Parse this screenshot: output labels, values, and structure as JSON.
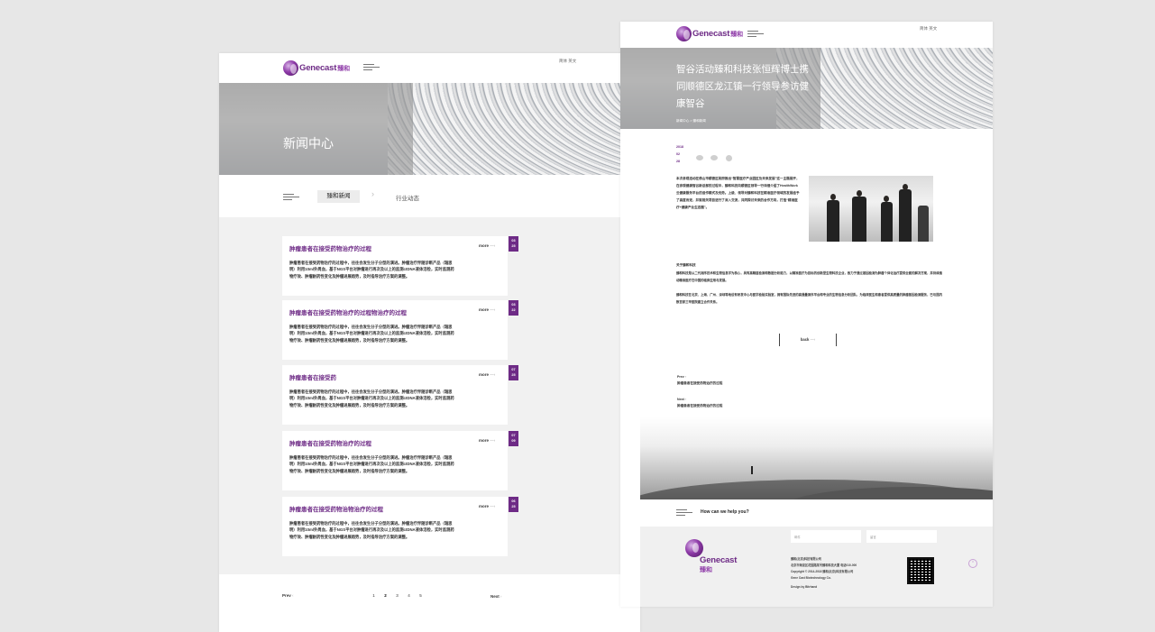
{
  "brand": {
    "logo_text": "Genecast",
    "logo_cn": "臻和",
    "accent": "#6e2b86"
  },
  "news_page": {
    "lang": "简体 英文",
    "hero_title": "新闻中心",
    "tabs": {
      "active": "臻和新闻",
      "other": "行业动态"
    },
    "more_label": "more",
    "cards": [
      {
        "title": "肿瘤患者在接受药物治疗的过程",
        "desc": "肿瘤患者在接受药物治疗的过程中，往往会发生分子分型的演进。肿瘤治疗伴随诊断产品（瑞思明）利用10ml外周血，基于NGS平台对肿瘤进行再次及以上的监测ctDNA液体活检，实时监测药物疗效、肿瘤耐药性变化及肿瘤进展趋势，及时指导治疗方案的调整。",
        "date_day": "03",
        "date_month": "25"
      },
      {
        "title": "肿瘤患者在接受药物治疗的过程物治疗的过程",
        "desc": "肿瘤患者在接受药物治疗的过程中，往往会发生分子分型的演进。肿瘤治疗伴随诊断产品（瑞思明）利用10ml外周血，基于NGS平台对肿瘤进行再次及以上的监测ctDNA液体活检，实时监测药物疗效、肿瘤耐药性变化及肿瘤进展趋势，及时指导治疗方案的调整。",
        "date_day": "03",
        "date_month": "22"
      },
      {
        "title": "肿瘤患者在接受药",
        "desc": "肿瘤患者在接受药物治疗的过程中，往往会发生分子分型的演进。肿瘤治疗伴随诊断产品（瑞思明）利用10ml外周血，基于NGS平台对肿瘤进行再次及以上的监测ctDNA液体活检，实时监测药物疗效、肿瘤耐药性变化及肿瘤进展趋势，及时指导治疗方案的调整。",
        "date_day": "07",
        "date_month": "25"
      },
      {
        "title": "肿瘤患者在接受药物治疗的过程",
        "desc": "肿瘤患者在接受药物治疗的过程中，往往会发生分子分型的演进。肿瘤治疗伴随诊断产品（瑞思明）利用10ml外周血，基于NGS平台对肿瘤进行再次及以上的监测ctDNA液体活检，实时监测药物疗效、肿瘤耐药性变化及肿瘤进展趋势，及时指导治疗方案的调整。",
        "date_day": "07",
        "date_month": "09"
      },
      {
        "title": "肿瘤患者在接受药物治物治疗的过程",
        "desc": "肿瘤患者在接受药物治疗的过程中，往往会发生分子分型的演进。肿瘤治疗伴随诊断产品（瑞思明）利用10ml外周血，基于NGS平台对肿瘤进行再次及以上的监测ctDNA液体活检，实时监测药物疗效、肿瘤耐药性变化及肿瘤进展趋势，及时指导治疗方案的调整。",
        "date_day": "06",
        "date_month": "25"
      }
    ],
    "pager": {
      "prev": "Prev",
      "pages": [
        "1",
        "2",
        "3",
        "4",
        "5"
      ],
      "current": "2",
      "next": "Next"
    }
  },
  "article_page": {
    "lang": "简体 英文",
    "hero_title": "智谷活动臻和科技张恒辉博士携同顺德区龙江镇一行领导参访健康智谷",
    "breadcrumb": "新闻中心 > 臻和新闻",
    "date": {
      "year": "2018",
      "month": "02",
      "day": "28"
    },
    "body": "本次参观活动在佛山市顺德区政府推出“智慧医疗产业园区及未来发展”这一主题展开，在参观健康智谷新总部的过程中，臻和科技向顺德区领导一行详细介绍了HealthWork云健康服务平台的运作模式及优势。上级、领导对臻和科技在精准医疗领域的发展给予了高度肯定，并就相关项目进行了深入交流，共同探讨未来的合作方向，打造“精准医疗+健康产业生态圈”。",
    "about_title": "关于臻和科技",
    "about_p1": "臻和科技是以二代测序技术和生物信息学为核心，具有高精度检测和数据分析能力，以精准医疗为目标的创新型生物科技企业，致力于通过基因检测为肿瘤个体化治疗提供全面的解决方案，并持续推动精准医疗在中国的临床应用与发展。",
    "about_p2": "臻和科技在北京、上海、广州、深圳等地设有研发中心与医学检验实验室，拥有国际先进的高通量测序平台和专业的生物信息分析团队，为临床医生和患者提供高质量的肿瘤基因检测服务，已与国内数百家三甲医院建立合作关系。",
    "back_label": "back",
    "prev_label": "Prev",
    "prev_title": "肿瘤患者在接受药物治疗的过程",
    "next_label": "Next",
    "next_title": "肿瘤患者在接受药物治疗的过程",
    "help_text": "How can we help you?",
    "footer": {
      "input1_placeholder": "邮件",
      "input2_placeholder": "留言",
      "company": "臻和(北京)科技有限公司",
      "address": "北京市海淀区花园路某号臻和科技大厦 电话010-000",
      "copyright": "Copyright © 2014-2018 臻和(北京)科技有限公司",
      "company_en": "Gene Cast Biotechnology Co.",
      "design": "Design by Bitrhand",
      "logo_text": "Genecast",
      "logo_cn": "臻和"
    }
  }
}
